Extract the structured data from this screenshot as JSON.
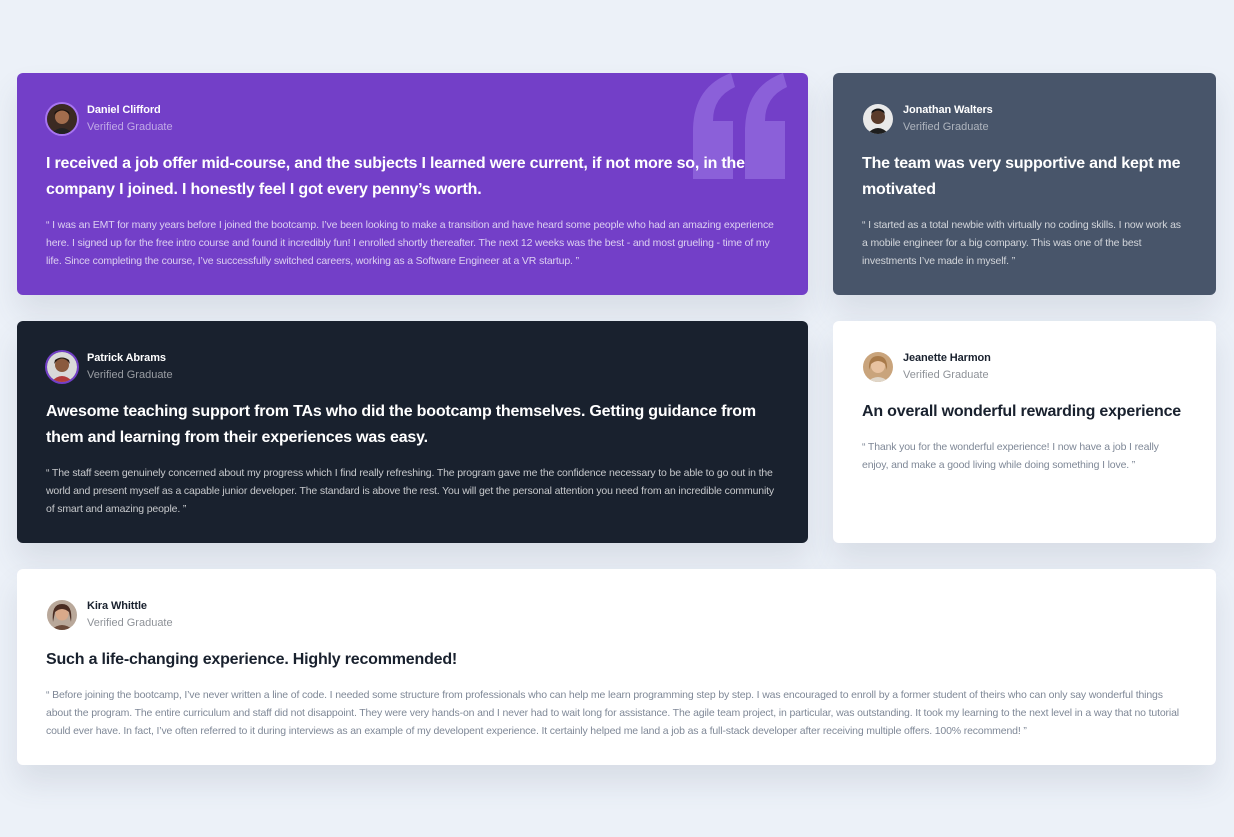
{
  "colors": {
    "background": "#ecf1f8",
    "purple": "#733fc8",
    "slate": "#48556a",
    "dark": "#19212e",
    "white": "#ffffff"
  },
  "testimonials": [
    {
      "name": "Daniel Clifford",
      "role": "Verified Graduate",
      "headline": "I received a job offer mid-course, and the subjects I learned were current, if not more so, in the company I joined. I honestly feel I got every penny’s worth.",
      "quote": "“ I was an EMT for many years before I joined the bootcamp. I’ve been looking to make a transition and have heard some people who had an amazing experience here. I signed up for the free intro course and found it incredibly fun! I enrolled shortly thereafter. The next 12 weeks was the best - and most grueling - time of my life. Since completing the course, I’ve successfully switched careers, working as a Software Engineer at a VR startup. ”",
      "avatar_icon": "avatar-daniel-icon"
    },
    {
      "name": "Jonathan Walters",
      "role": "Verified Graduate",
      "headline": "The team was very supportive and kept me motivated",
      "quote": "“ I started as a total newbie with virtually no coding skills. I now work as a mobile engineer for a big company. This was one of the best investments I’ve made in myself. ”",
      "avatar_icon": "avatar-jonathan-icon"
    },
    {
      "name": "Patrick Abrams",
      "role": "Verified Graduate",
      "headline": "Awesome teaching support from TAs who did the bootcamp themselves. Getting guidance from them and learning from their experiences was easy.",
      "quote": "“ The staff seem genuinely concerned about my progress which I find really refreshing. The program gave me the confidence necessary to be able to go out in the world and present myself as a capable junior developer. The standard is above the rest. You will get the personal attention you need from an incredible community of smart and amazing people. ”",
      "avatar_icon": "avatar-patrick-icon"
    },
    {
      "name": "Jeanette Harmon",
      "role": "Verified Graduate",
      "headline": "An overall wonderful rewarding experience",
      "quote": "“ Thank you for the wonderful experience! I now have a job I really enjoy, and make a good living while doing something I love. ”",
      "avatar_icon": "avatar-jeanette-icon"
    },
    {
      "name": "Kira Whittle",
      "role": "Verified Graduate",
      "headline": "Such a life-changing experience. Highly recommended!",
      "quote": "“ Before joining the bootcamp, I’ve never written a line of code. I needed some structure from professionals who can help me learn programming step by step. I was encouraged to enroll by a former student of theirs who can only say wonderful things about the program. The entire curriculum and staff did not disappoint. They were very hands-on and I never had to wait long for assistance. The agile team project, in particular, was outstanding. It took my learning to the next level in a way that no tutorial could ever have. In fact, I’ve often referred to it during interviews as an example of my developent experience. It certainly helped me land a job as a full-stack developer after receiving multiple offers. 100% recommend! ”",
      "avatar_icon": "avatar-kira-icon"
    }
  ],
  "decoration": {
    "quote_mark_icon": "quote-mark-icon"
  }
}
